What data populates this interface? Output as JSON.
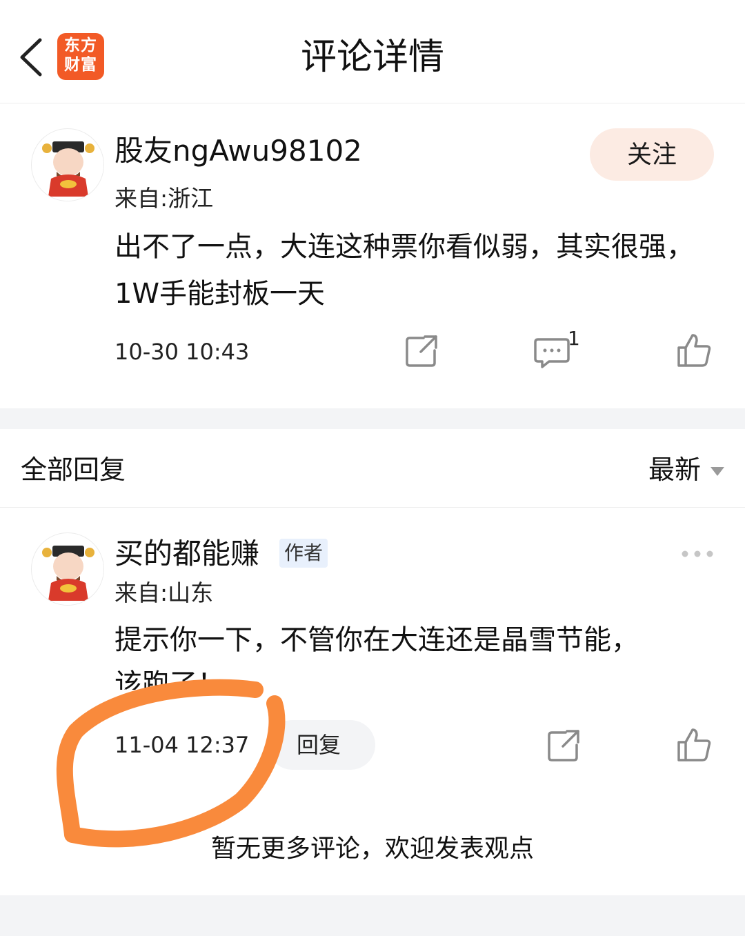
{
  "header": {
    "title": "评论详情",
    "logo_line1": "东方",
    "logo_line2": "财富"
  },
  "comment": {
    "username": "股友ngAwu98102",
    "location": "来自:浙江",
    "content": "出不了一点，大连这种票你看似弱，其实很强，1W手能封板一天",
    "timestamp": "10-30 10:43",
    "follow_label": "关注",
    "reply_count": "1"
  },
  "replies": {
    "title": "全部回复",
    "sort_label": "最新",
    "items": [
      {
        "username": "买的都能赚",
        "badge": "作者",
        "location": "来自:山东",
        "content_line1": "提示你一下，不管你在大连还是晶雪节能，",
        "content_line2": "该跑了！",
        "timestamp": "11-04 12:37",
        "reply_label": "回复"
      }
    ],
    "end_note": "暂无更多评论，欢迎发表观点"
  },
  "colors": {
    "brand": "#f25a26",
    "follow_bg": "#fcebe3",
    "badge_bg": "#e8f0fc",
    "band_bg": "#f3f4f6",
    "scribble": "#f98a3c"
  }
}
